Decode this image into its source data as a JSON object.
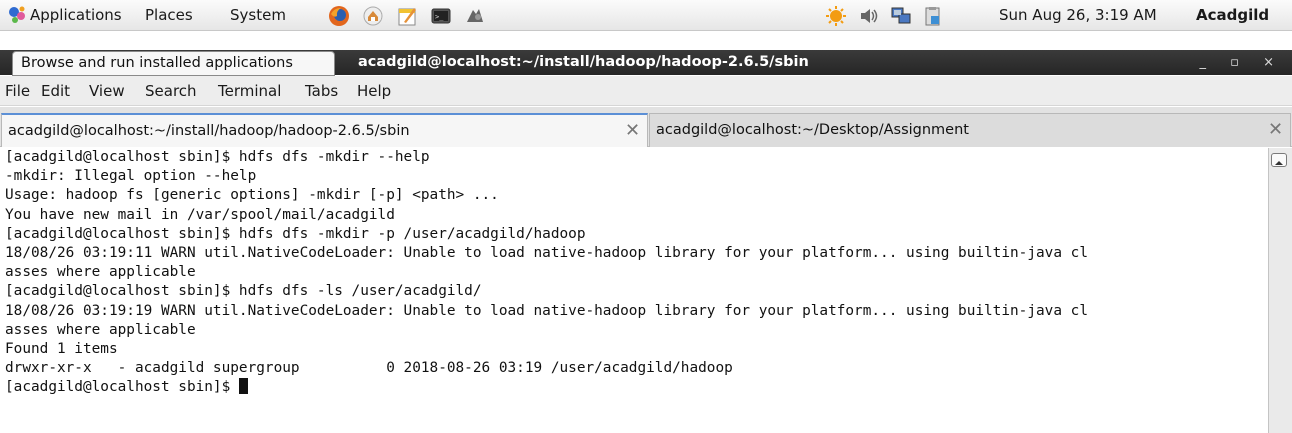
{
  "panel": {
    "menus": [
      "Applications",
      "Places",
      "System"
    ],
    "clock": "Sun Aug 26,  3:19 AM",
    "user": "Acadgild",
    "launcher_icons": [
      "firefox-icon",
      "network-places-icon",
      "text-editor-icon",
      "terminal-icon",
      "screenshot-icon"
    ],
    "tray_icons": [
      "updates-icon",
      "volume-icon",
      "network-icon",
      "clipboard-icon"
    ]
  },
  "tooltip": "Browse and run installed applications",
  "window": {
    "title": "acadgild@localhost:~/install/hadoop/hadoop-2.6.5/sbin",
    "controls": "_ ▫ ×"
  },
  "menubar": [
    "File",
    "Edit",
    "View",
    "Search",
    "Terminal",
    "Tabs",
    "Help"
  ],
  "tabs": [
    {
      "label": "acadgild@localhost:~/install/hadoop/hadoop-2.6.5/sbin",
      "active": true
    },
    {
      "label": "acadgild@localhost:~/Desktop/Assignment",
      "active": false
    }
  ],
  "terminal": {
    "lines": [
      "[acadgild@localhost sbin]$ hdfs dfs -mkdir --help",
      "-mkdir: Illegal option --help",
      "Usage: hadoop fs [generic options] -mkdir [-p] <path> ...",
      "You have new mail in /var/spool/mail/acadgild",
      "[acadgild@localhost sbin]$ hdfs dfs -mkdir -p /user/acadgild/hadoop",
      "18/08/26 03:19:11 WARN util.NativeCodeLoader: Unable to load native-hadoop library for your platform... using builtin-java cl",
      "asses where applicable",
      "[acadgild@localhost sbin]$ hdfs dfs -ls /user/acadgild/",
      "18/08/26 03:19:19 WARN util.NativeCodeLoader: Unable to load native-hadoop library for your platform... using builtin-java cl",
      "asses where applicable",
      "Found 1 items",
      "drwxr-xr-x   - acadgild supergroup          0 2018-08-26 03:19 /user/acadgild/hadoop"
    ],
    "prompt": "[acadgild@localhost sbin]$ "
  }
}
